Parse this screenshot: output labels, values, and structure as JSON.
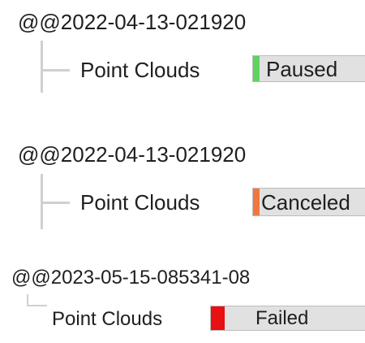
{
  "groups": [
    {
      "header": "@@2022-04-13-021920",
      "item_label": "Point Clouds",
      "status": "Paused",
      "progress_fraction": 0.06,
      "progress_color": "#5fd35f"
    },
    {
      "header": "@@2022-04-13-021920",
      "item_label": "Point Clouds",
      "status": "Canceled",
      "progress_fraction": 0.06,
      "progress_color": "#f07840"
    },
    {
      "header": "@@2023-05-15-085341-08",
      "item_label": "Point Clouds",
      "status": "Failed",
      "progress_fraction": 0.09,
      "progress_color": "#e81010"
    }
  ],
  "colors": {
    "tree_line": "#d0d0d0",
    "bar_background": "#e1e1e1",
    "text": "#1f1f1f"
  }
}
